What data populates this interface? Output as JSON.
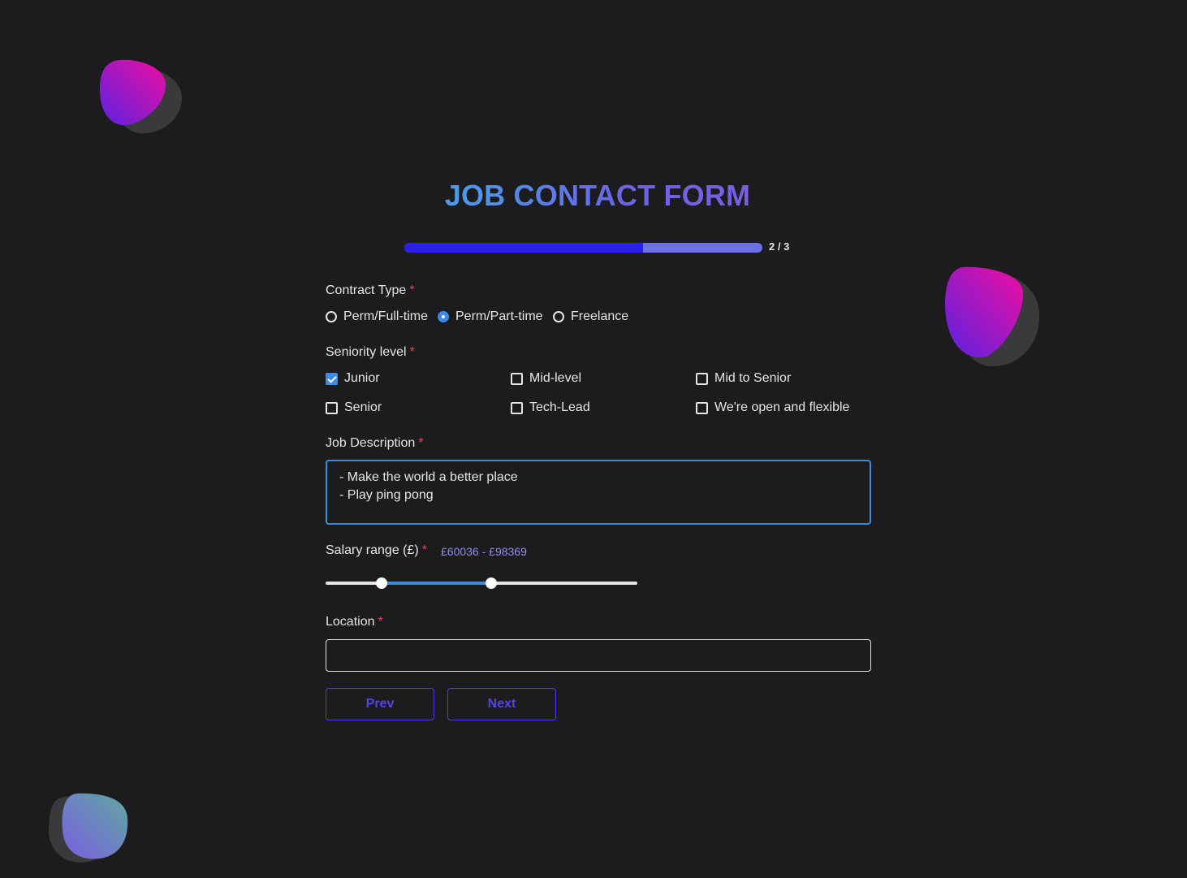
{
  "form": {
    "title": "JOB CONTACT FORM",
    "progress": {
      "text": "2 / 3",
      "fill_fraction": 0.667
    },
    "required_marker": "*",
    "contract_type": {
      "label": "Contract Type",
      "options": [
        "Perm/Full-time",
        "Perm/Part-time",
        "Freelance"
      ],
      "selected": "Perm/Part-time"
    },
    "seniority": {
      "label": "Seniority level",
      "options": [
        "Junior",
        "Mid-level",
        "Mid to Senior",
        "Senior",
        "Tech-Lead",
        "We're open and flexible"
      ],
      "checked": [
        "Junior"
      ]
    },
    "job_description": {
      "label": "Job Description",
      "value": "- Make the world a better place\n- Play ping pong"
    },
    "salary": {
      "label": "Salary range (£)",
      "value_text": "£60036 - £98369",
      "min_fraction": 0.18,
      "max_fraction": 0.53
    },
    "location": {
      "label": "Location",
      "value": ""
    },
    "buttons": {
      "prev": "Prev",
      "next": "Next"
    }
  },
  "colors": {
    "background": "#1c1b1d",
    "accent": "#3b8be5",
    "progress_fill": "#2a1ff0",
    "progress_track": "#6c72e6",
    "button": "#5046ea",
    "required": "#e5484d"
  }
}
